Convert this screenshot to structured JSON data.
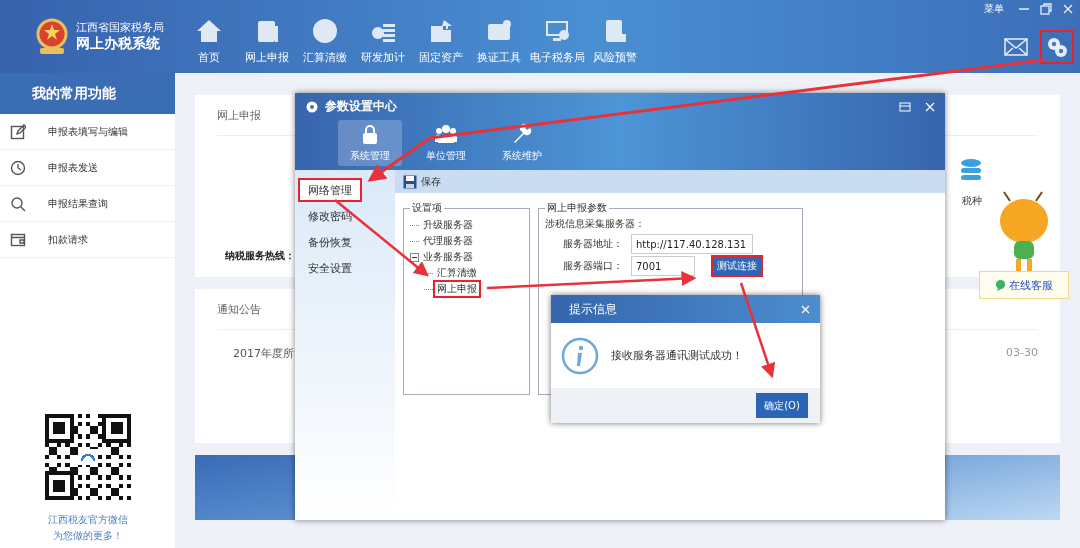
{
  "header": {
    "org_name": "江西省国家税务局",
    "system_name": "网上办税系统",
    "menu_label": "菜单",
    "nav": [
      {
        "label": "首页"
      },
      {
        "label": "网上申报"
      },
      {
        "label": "汇算清缴"
      },
      {
        "label": "研发加计"
      },
      {
        "label": "固定资产"
      },
      {
        "label": "换证工具"
      },
      {
        "label": "电子税务局"
      },
      {
        "label": "风险预警"
      }
    ],
    "settings_button": {
      "highlighted": true
    }
  },
  "sidebar": {
    "title": "我的常用功能",
    "items": [
      {
        "label": "申报表填写与编辑"
      },
      {
        "label": "申报表发送"
      },
      {
        "label": "申报结果查询"
      },
      {
        "label": "扣款请求"
      }
    ],
    "qr_caption": [
      "江西税友官方微信",
      "为您做的更多！"
    ]
  },
  "main": {
    "declare_card": {
      "title": "网上申报",
      "hotline": "纳税服务热线：",
      "right_item": "税种",
      "online_service": "在线客服"
    },
    "notice_card": {
      "title": "通知公告",
      "items": [
        {
          "title": "2017年度所",
          "date": "03-30"
        }
      ]
    }
  },
  "settings_dialog": {
    "title": "参数设置中心",
    "tabs": [
      {
        "label": "系统管理",
        "selected": true
      },
      {
        "label": "单位管理",
        "selected": false
      },
      {
        "label": "系统维护",
        "selected": false
      }
    ],
    "nav": [
      {
        "label": "网络管理",
        "highlighted": true
      },
      {
        "label": "修改密码",
        "highlighted": false
      },
      {
        "label": "备份恢复",
        "highlighted": false
      },
      {
        "label": "安全设置",
        "highlighted": false
      }
    ],
    "save_label": "保存",
    "tree_group": {
      "title": "设置项",
      "items": [
        {
          "label": "升级服务器",
          "highlighted": false
        },
        {
          "label": "代理服务器",
          "highlighted": false
        },
        {
          "label": "业务服务器",
          "highlighted": false,
          "expanded": true,
          "children": [
            {
              "label": "汇算清缴",
              "highlighted": false
            },
            {
              "label": "网上申报",
              "highlighted": true
            }
          ]
        }
      ]
    },
    "params_group": {
      "title": "网上申报参数",
      "subtitle": "涉税信息采集服务器：",
      "address_label": "服务器地址：",
      "address_value": "http://117.40.128.131",
      "port_label": "服务器端口：",
      "port_value": "7001",
      "test_button": {
        "label": "测试连接",
        "highlighted": true
      }
    }
  },
  "message_box": {
    "title": "提示信息",
    "message": "接收服务器通讯测试成功！",
    "ok_label": "确定(O)"
  }
}
